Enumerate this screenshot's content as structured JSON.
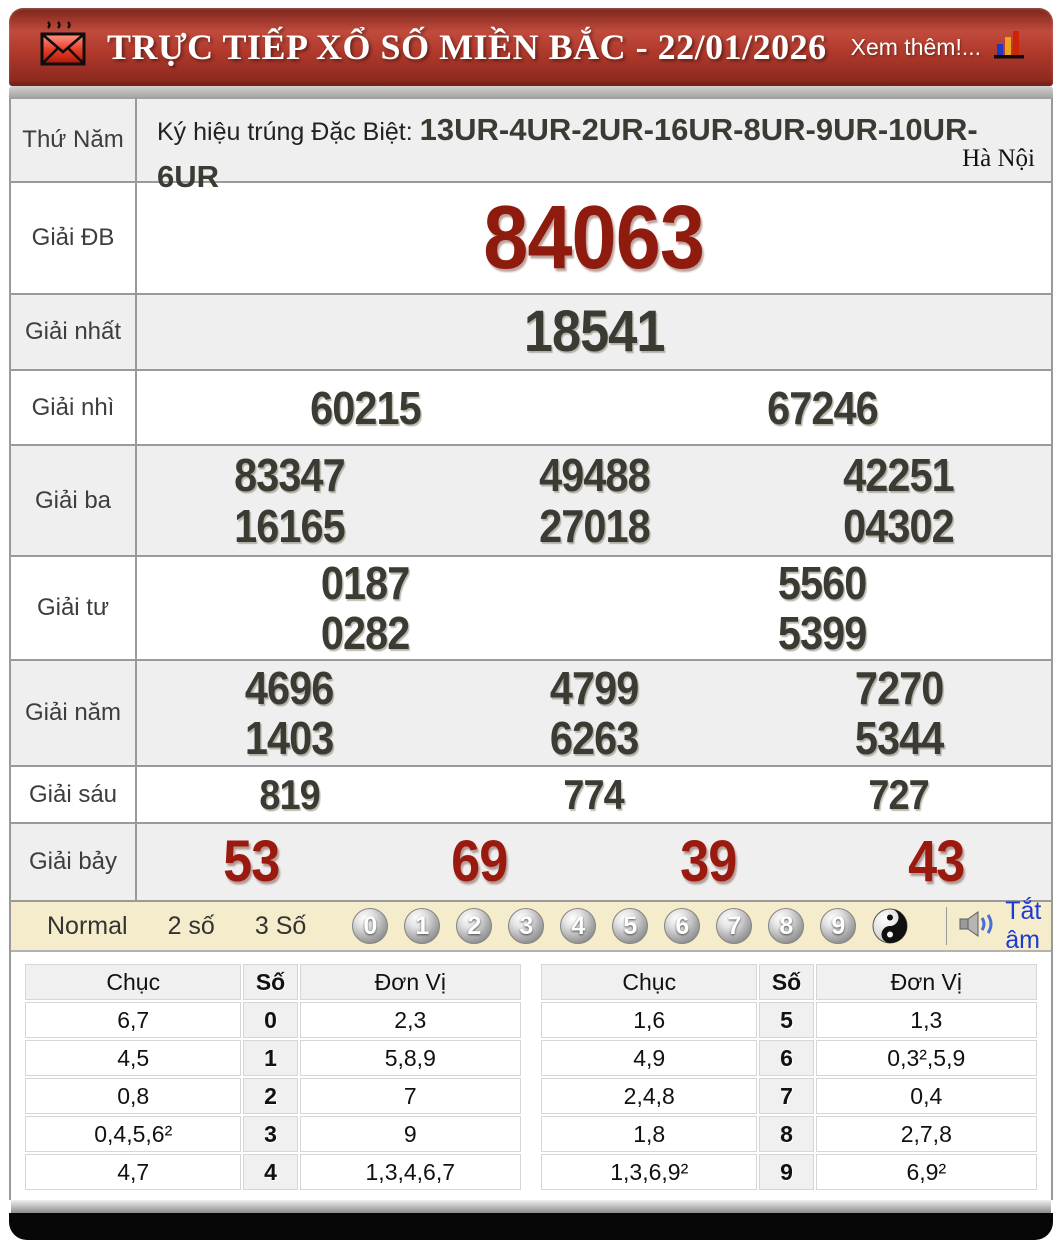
{
  "header": {
    "title": "TRỰC TIẾP XỔ SỐ MIỀN BẮC - 22/01/2026",
    "more_link": "Xem thêm!..."
  },
  "results": {
    "day": "Thứ Năm",
    "sign_label": "Ký hiệu trúng Đặc Biệt:",
    "sign_value": "13UR-4UR-2UR-16UR-8UR-9UR-10UR-6UR",
    "province": "Hà Nội",
    "prizes": {
      "db": {
        "label": "Giải ĐB",
        "numbers": [
          "84063"
        ]
      },
      "nhat": {
        "label": "Giải nhất",
        "numbers": [
          "18541"
        ]
      },
      "nhi": {
        "label": "Giải nhì",
        "numbers": [
          "60215",
          "67246"
        ]
      },
      "ba": {
        "label": "Giải ba",
        "lines": [
          [
            "83347",
            "49488",
            "42251"
          ],
          [
            "16165",
            "27018",
            "04302"
          ]
        ]
      },
      "tu": {
        "label": "Giải tư",
        "lines": [
          [
            "0187",
            "5560"
          ],
          [
            "0282",
            "5399"
          ]
        ]
      },
      "nam": {
        "label": "Giải năm",
        "lines": [
          [
            "4696",
            "4799",
            "7270"
          ],
          [
            "1403",
            "6263",
            "5344"
          ]
        ]
      },
      "sau": {
        "label": "Giải sáu",
        "numbers": [
          "819",
          "774",
          "727"
        ]
      },
      "bay": {
        "label": "Giải bảy",
        "numbers": [
          "53",
          "69",
          "39",
          "43"
        ]
      }
    }
  },
  "controls": {
    "modes": [
      "Normal",
      "2 số",
      "3 Số"
    ],
    "balls": [
      "0",
      "1",
      "2",
      "3",
      "4",
      "5",
      "6",
      "7",
      "8",
      "9"
    ],
    "mute_label": "Tắt âm"
  },
  "stats": {
    "col_tens": "Chục",
    "col_digit": "Số",
    "col_units": "Đơn Vị",
    "left": [
      {
        "tens": "6,7",
        "digit": "0",
        "units": "2,3"
      },
      {
        "tens": "4,5",
        "digit": "1",
        "units": "5,8,9"
      },
      {
        "tens": "0,8",
        "digit": "2",
        "units": "7"
      },
      {
        "tens": "0,4,5,6²",
        "digit": "3",
        "units": "9"
      },
      {
        "tens": "4,7",
        "digit": "4",
        "units": "1,3,4,6,7"
      }
    ],
    "right": [
      {
        "tens": "1,6",
        "digit": "5",
        "units": "1,3"
      },
      {
        "tens": "4,9",
        "digit": "6",
        "units": "0,3²,5,9"
      },
      {
        "tens": "2,4,8",
        "digit": "7",
        "units": "0,4"
      },
      {
        "tens": "1,8",
        "digit": "8",
        "units": "2,7,8"
      },
      {
        "tens": "1,3,6,9²",
        "digit": "9",
        "units": "6,9²"
      }
    ]
  },
  "icons": {
    "envelope-icon": "✉",
    "bar-chart-icon": "📊",
    "yin-yang-icon": "☯",
    "speaker-icon": "🔊"
  },
  "colors": {
    "header_red": "#a93226",
    "prize_special_red": "#8e1b0e",
    "prize_seven_red": "#9b1a10",
    "number_dark": "#3b3a33",
    "control_bar_bg": "#f4ecca",
    "mute_blue": "#1c3bd6"
  }
}
